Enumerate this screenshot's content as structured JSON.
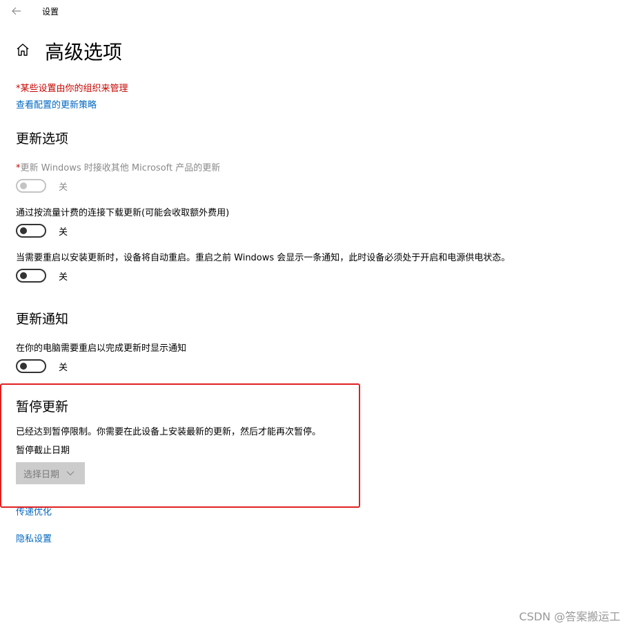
{
  "window": {
    "title": "设置"
  },
  "page": {
    "title": "高级选项"
  },
  "notice": {
    "managed": "*某些设置由你的组织来管理",
    "policy_link": "查看配置的更新策略"
  },
  "update_options": {
    "heading": "更新选项",
    "items": [
      {
        "star": "*",
        "label": "更新 Windows 时接收其他 Microsoft 产品的更新",
        "state": "关",
        "disabled": true
      },
      {
        "star": "",
        "label": "通过按流量计费的连接下载更新(可能会收取额外费用)",
        "state": "关",
        "disabled": false
      },
      {
        "star": "",
        "label": "当需要重启以安装更新时，设备将自动重启。重启之前 Windows 会显示一条通知，此时设备必须处于开启和电源供电状态。",
        "state": "关",
        "disabled": false
      }
    ]
  },
  "update_notifications": {
    "heading": "更新通知",
    "label": "在你的电脑需要重启以完成更新时显示通知",
    "state": "关"
  },
  "pause_updates": {
    "heading": "暂停更新",
    "text": "已经达到暂停限制。你需要在此设备上安装最新的更新，然后才能再次暂停。",
    "date_label": "暂停截止日期",
    "date_picker": "选择日期"
  },
  "links": {
    "delivery_optimization": "传递优化",
    "privacy": "隐私设置"
  },
  "watermark": "CSDN @答案搬运工",
  "colors": {
    "accent": "#0067c0",
    "warning": "#c50500",
    "highlight_box": "#e02020"
  },
  "icons": {
    "back": "arrow-left",
    "home": "home",
    "chevron": "chevron-down"
  }
}
